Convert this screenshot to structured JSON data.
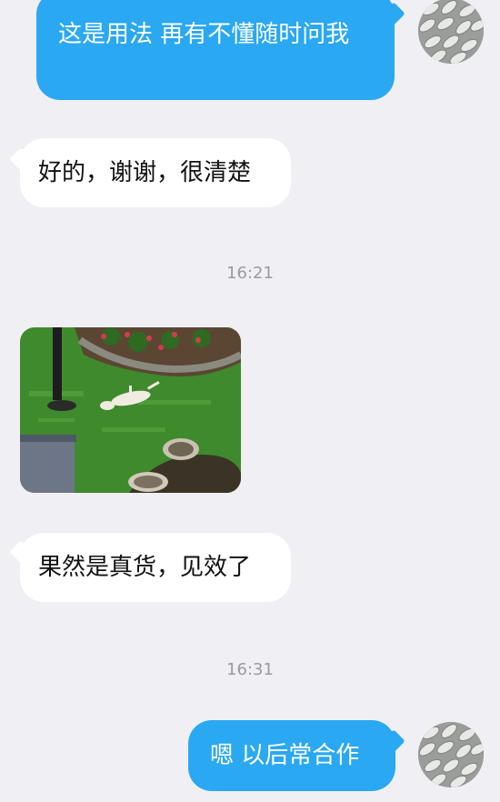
{
  "messages": {
    "m1": "这是用法  再有不懂随时问我",
    "m2": "好的，谢谢，很清楚",
    "t1": "16:21",
    "m3": "果然是真货，见效了",
    "t2": "16:31",
    "m4": "嗯  以后常合作"
  },
  "colors": {
    "background": "#efeff4",
    "outgoing_bubble": "#2aa8f2",
    "incoming_bubble": "#ffffff",
    "timestamp": "#9a9a9f"
  },
  "icons": {
    "avatar": "user-avatar-image",
    "photo": "garden-cat-photo"
  }
}
